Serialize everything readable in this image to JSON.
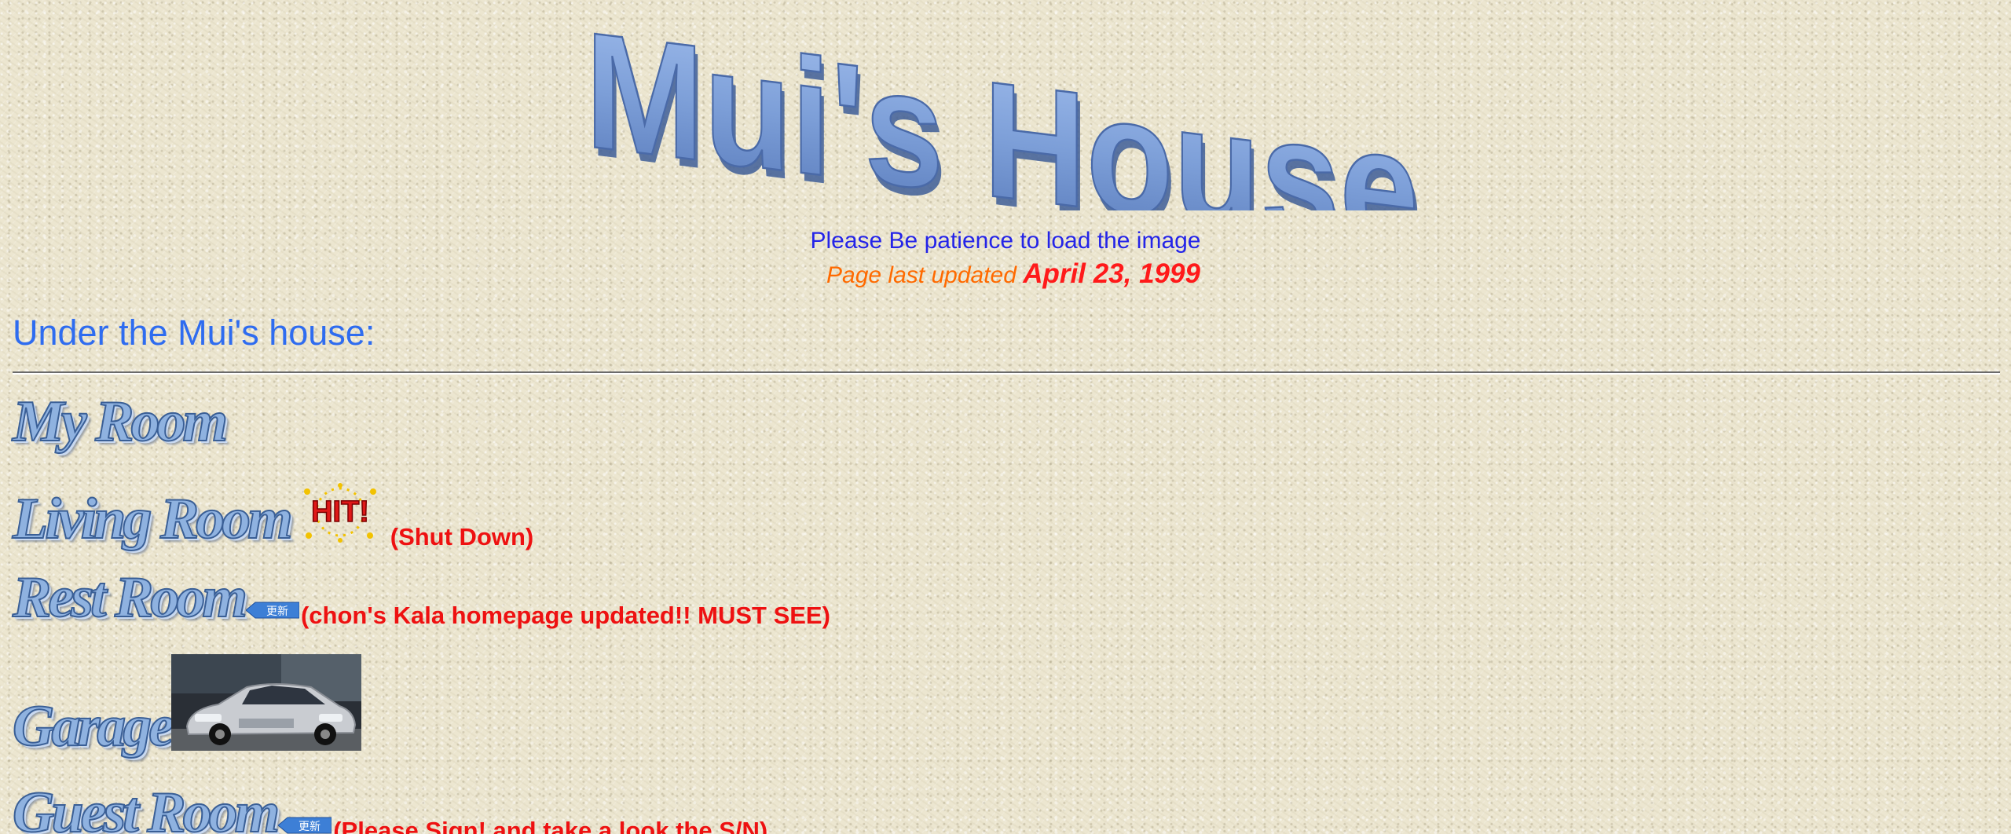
{
  "header": {
    "logo_text": "Mui's House",
    "notice": "Please Be patience to load the image",
    "updated_label": "Page last updated",
    "updated_date": "April 23, 1999"
  },
  "section": {
    "heading": "Under the Mui's house:"
  },
  "rooms": [
    {
      "label": "My Room",
      "note": ""
    },
    {
      "label": "Living Room",
      "note": "(Shut Down)",
      "badge": "HIT!"
    },
    {
      "label": "Rest Room",
      "note": "(chon's Kala homepage updated!! MUST SEE)",
      "badge": "更新"
    },
    {
      "label": "Garage",
      "note": ""
    },
    {
      "label": "Guest Room",
      "note": "(Please Sign! and take a look the S/N)",
      "badge": "更新"
    }
  ],
  "colors": {
    "background": "#ece6d0",
    "logo_fill": "#7d9fd8",
    "notice_blue": "#2424e8",
    "updated_orange": "#ff6a00",
    "note_red": "#ee1111",
    "heading_blue": "#2e6cf0"
  }
}
